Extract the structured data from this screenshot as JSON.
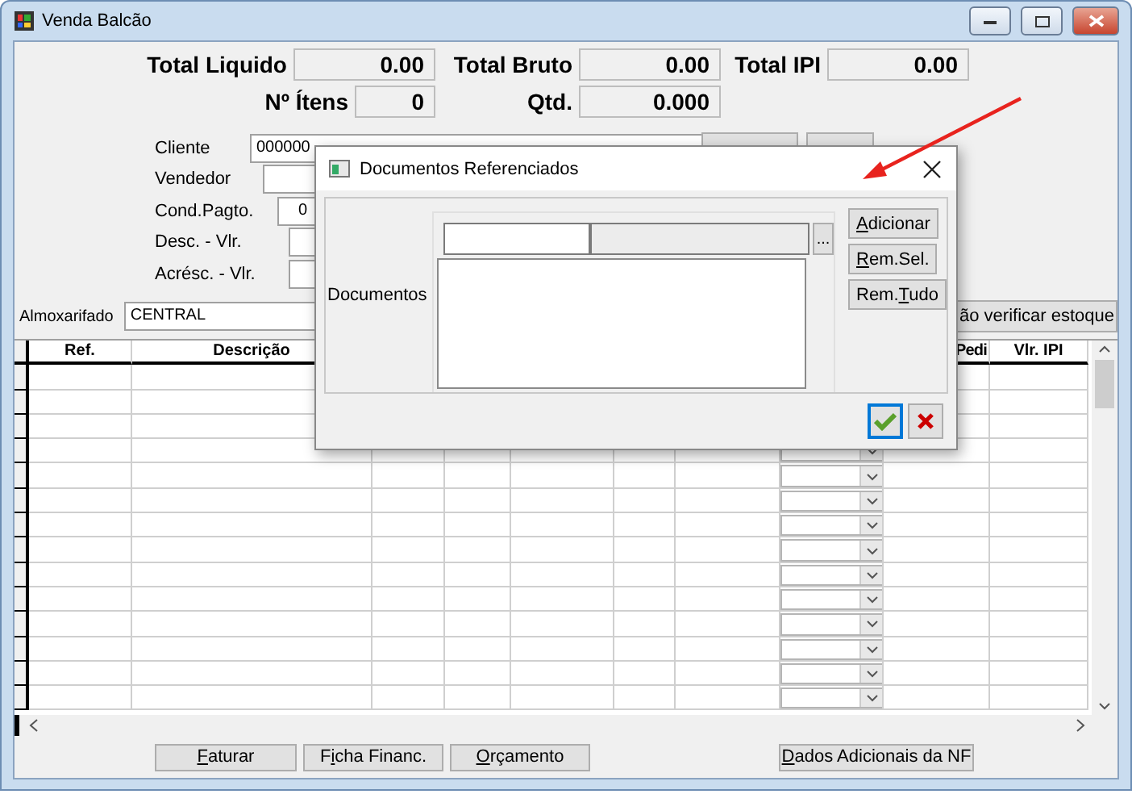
{
  "window": {
    "title": "Venda Balcão"
  },
  "totals": [
    {
      "label": "Total Liquido",
      "value": "0.00"
    },
    {
      "label": "Total Bruto",
      "value": "0.00"
    },
    {
      "label": "Total IPI",
      "value": "0.00"
    },
    {
      "label": "Nº Ítens",
      "value": "0"
    },
    {
      "label": "Qtd.",
      "value": "0.000"
    }
  ],
  "form": [
    {
      "label": "Cliente",
      "value": "000000"
    },
    {
      "label": "Vendedor"
    },
    {
      "label": "Cond.Pagto.",
      "value": "0"
    },
    {
      "label": "Desc. - Vlr."
    },
    {
      "label": "Acrésc. - Vlr."
    }
  ],
  "almoxarifado": {
    "label": "Almoxarifado",
    "value": "CENTRAL",
    "button": "ão verificar estoque"
  },
  "table": {
    "columns": [
      {
        "label": "Ref."
      },
      {
        "label": "Descrição"
      },
      {},
      {},
      {},
      {},
      {},
      {
        "kind": "combo"
      },
      {
        "label": "Pedi"
      },
      {
        "label": "Vlr. IPI"
      }
    ]
  },
  "buttons": [
    {
      "key": "F",
      "after": "aturar"
    },
    {
      "before": "F",
      "key": "i",
      "after": "cha Financ."
    },
    {
      "key": "O",
      "after": "rçamento"
    },
    {
      "key": "D",
      "after": "ados Adicionais da NF"
    }
  ],
  "dialog": {
    "title": "Documentos Referenciados",
    "label": "Documentos",
    "buttons": [
      {
        "key": "A",
        "after": "dicionar"
      },
      {
        "key": "R",
        "after": "em.Sel."
      },
      {
        "before": "Rem.",
        "key": "T",
        "after": "udo"
      }
    ],
    "browse": "...",
    "ok_focused": true
  }
}
